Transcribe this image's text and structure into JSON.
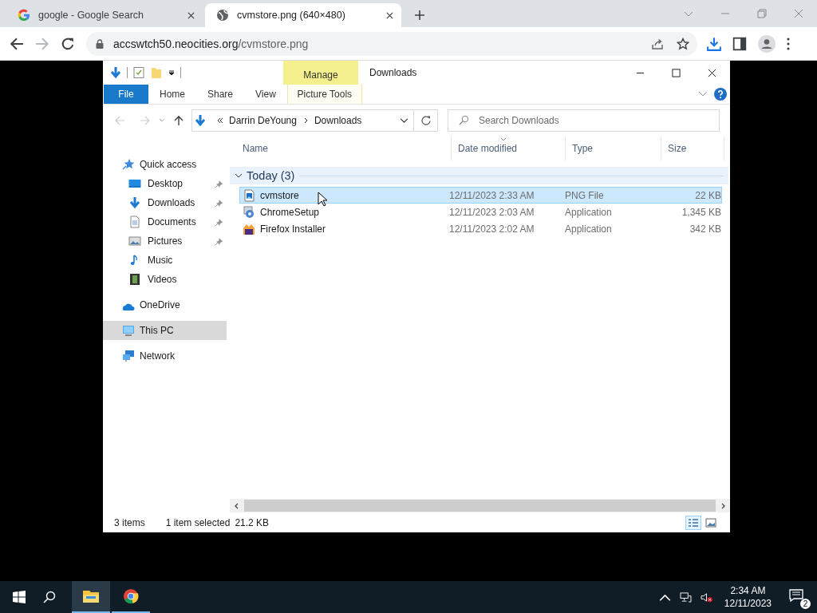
{
  "browser": {
    "tabs": [
      {
        "title": "google - Google Search",
        "selected": false
      },
      {
        "title": "cvmstore.png (640×480)",
        "selected": true
      }
    ],
    "url_host": "accswtch50.neocities.org",
    "url_path": "/cvmstore.png"
  },
  "explorer": {
    "title": "Downloads",
    "context_group": "Manage",
    "ribbon_tabs": [
      {
        "label": "File",
        "kind": "file"
      },
      {
        "label": "Home",
        "kind": "tab"
      },
      {
        "label": "Share",
        "kind": "tab"
      },
      {
        "label": "View",
        "kind": "tab"
      },
      {
        "label": "Picture Tools",
        "kind": "contextual"
      }
    ],
    "breadcrumb": [
      "Darrin DeYoung",
      "Downloads"
    ],
    "search": {
      "placeholder": "Search Downloads"
    },
    "nav": [
      {
        "label": "Quick access",
        "selected": false,
        "children": [
          {
            "label": "Desktop",
            "pinned": true,
            "selected": false
          },
          {
            "label": "Downloads",
            "pinned": true,
            "selected": false
          },
          {
            "label": "Documents",
            "pinned": true,
            "selected": false
          },
          {
            "label": "Pictures",
            "pinned": true,
            "selected": false
          },
          {
            "label": "Music",
            "pinned": false,
            "selected": false
          },
          {
            "label": "Videos",
            "pinned": false,
            "selected": false
          }
        ]
      },
      {
        "label": "OneDrive",
        "selected": false
      },
      {
        "label": "This PC",
        "selected": true
      },
      {
        "label": "Network",
        "selected": false
      }
    ],
    "columns": [
      "Name",
      "Date modified",
      "Type",
      "Size"
    ],
    "group": {
      "label": "Today (3)",
      "expanded": true
    },
    "rows": [
      {
        "name": "cvmstore",
        "date": "12/11/2023 2:33 AM",
        "type": "PNG File",
        "size": "22 KB",
        "selected": true
      },
      {
        "name": "ChromeSetup",
        "date": "12/11/2023 2:03 AM",
        "type": "Application",
        "size": "1,345 KB",
        "selected": false
      },
      {
        "name": "Firefox Installer",
        "date": "12/11/2023 2:02 AM",
        "type": "Application",
        "size": "342 KB",
        "selected": false
      }
    ],
    "status": {
      "count": "3 items",
      "selection": "1 item selected",
      "size": "21.2 KB"
    },
    "views": [
      {
        "selected": true
      },
      {
        "selected": false
      }
    ]
  },
  "taskbar": {
    "apps": [
      {
        "active": true
      },
      {
        "active": false
      }
    ],
    "time": "2:34 AM",
    "date": "12/11/2023",
    "notifications": "2"
  }
}
